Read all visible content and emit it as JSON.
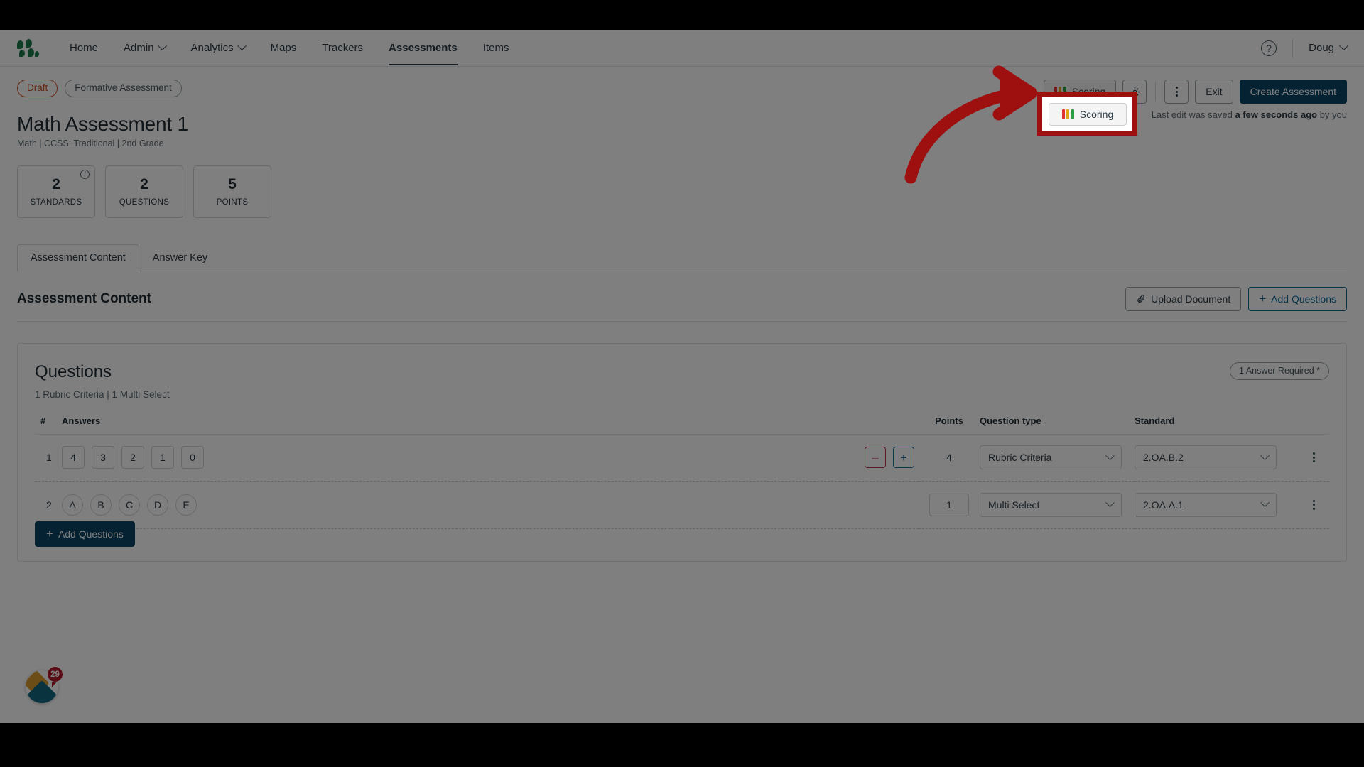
{
  "nav": {
    "logo_icon": "dots-logo-icon",
    "links": [
      {
        "label": "Home",
        "caret": false,
        "active": false
      },
      {
        "label": "Admin",
        "caret": true,
        "active": false
      },
      {
        "label": "Analytics",
        "caret": true,
        "active": false
      },
      {
        "label": "Maps",
        "caret": false,
        "active": false
      },
      {
        "label": "Trackers",
        "caret": false,
        "active": false
      },
      {
        "label": "Assessments",
        "caret": false,
        "active": true
      },
      {
        "label": "Items",
        "caret": false,
        "active": false
      }
    ],
    "help_label": "?",
    "user": "Doug"
  },
  "header": {
    "status_badge": "Draft",
    "type_badge": "Formative Assessment",
    "title": "Math Assessment 1",
    "subtitle": "Math  |  CCSS: Traditional  |  2nd Grade",
    "stats": [
      {
        "value": "2",
        "label": "STANDARDS",
        "info": true
      },
      {
        "value": "2",
        "label": "QUESTIONS",
        "info": false
      },
      {
        "value": "5",
        "label": "POINTS",
        "info": false
      }
    ],
    "actions": {
      "scoring_label": "Scoring",
      "scoring_bar_colors": [
        "#e03131",
        "#d9a514",
        "#2f9e44"
      ],
      "settings_icon": "gear-icon",
      "more_icon": "kebab-menu-icon",
      "exit_label": "Exit",
      "create_label": "Create Assessment"
    },
    "saved_prefix": "Last edit was saved ",
    "saved_strong": "a few seconds ago",
    "saved_suffix": " by you"
  },
  "tabs": [
    {
      "label": "Assessment Content",
      "active": true
    },
    {
      "label": "Answer Key",
      "active": false
    }
  ],
  "section": {
    "title": "Assessment Content",
    "upload_label": "Upload Document",
    "upload_icon": "paperclip-icon",
    "add_questions_label": "Add Questions",
    "add_icon": "plus-icon"
  },
  "questions": {
    "title": "Questions",
    "subtitle": "1 Rubric Criteria | 1 Multi Select",
    "required_pill": "1 Answer Required *",
    "columns": [
      "#",
      "Answers",
      "",
      "Points",
      "Question type",
      "Standard",
      ""
    ],
    "rows": [
      {
        "num": "1",
        "answers": [
          "4",
          "3",
          "2",
          "1",
          "0"
        ],
        "answer_shape": "square",
        "show_plus_minus": true,
        "minus_label": "–",
        "plus_label": "+",
        "points": "4",
        "points_boxed": false,
        "question_type": "Rubric Criteria",
        "standard": "2.OA.B.2"
      },
      {
        "num": "2",
        "answers": [
          "A",
          "B",
          "C",
          "D",
          "E"
        ],
        "answer_shape": "circle",
        "show_plus_minus": false,
        "points": "1",
        "points_boxed": true,
        "question_type": "Multi Select",
        "standard": "2.OA.A.1"
      }
    ],
    "add_button_label": "Add Questions"
  },
  "float_widget": {
    "name": "notifications-widget",
    "count": "29"
  },
  "annotation": {
    "highlight_target": "Scoring",
    "arrow_color": "#9e0f0f",
    "box_color": "#9e0f0f"
  }
}
